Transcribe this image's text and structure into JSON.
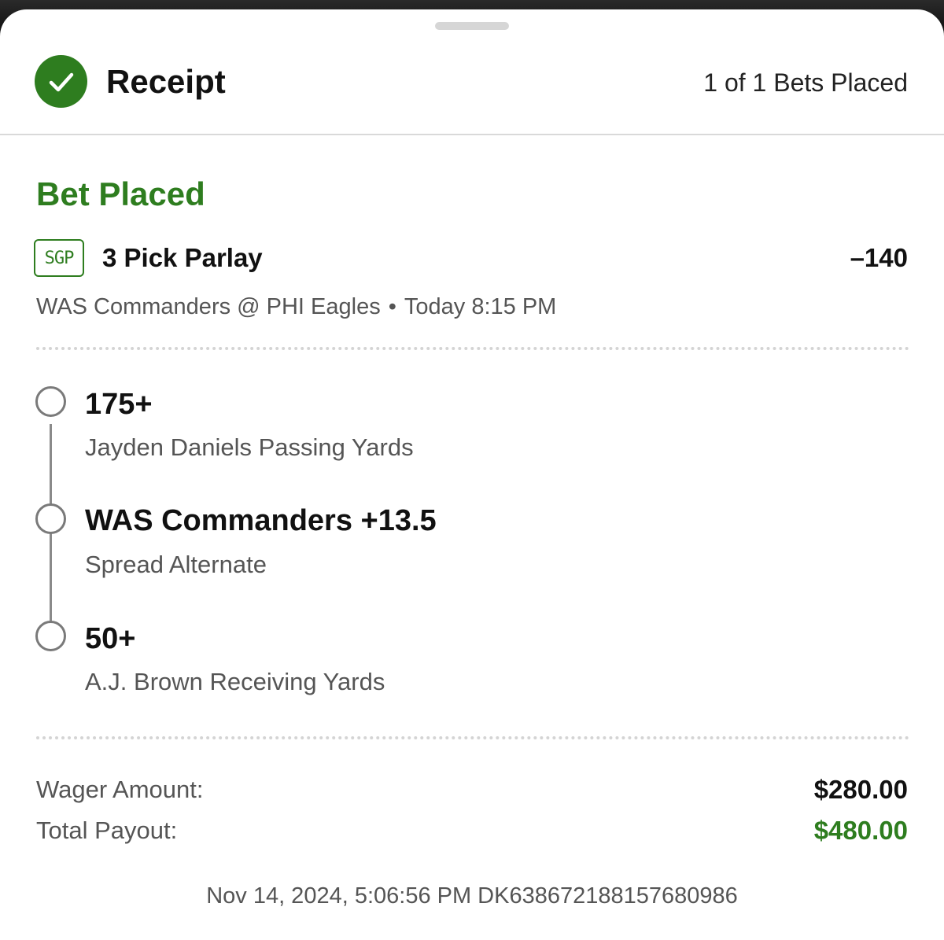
{
  "header": {
    "title": "Receipt",
    "bets_placed": "1 of 1 Bets Placed",
    "icon": "checkmark-circle-icon"
  },
  "bet": {
    "status": "Bet Placed",
    "badge": "SGP",
    "type": "3 Pick Parlay",
    "odds": "–140",
    "matchup": "WAS Commanders @ PHI Eagles",
    "separator": "•",
    "time": "Today 8:15 PM"
  },
  "legs": [
    {
      "pick": "175+",
      "market": "Jayden Daniels Passing Yards"
    },
    {
      "pick": "WAS Commanders +13.5",
      "market": "Spread Alternate"
    },
    {
      "pick": "50+",
      "market": "A.J. Brown Receiving Yards"
    }
  ],
  "summary": {
    "wager_label": "Wager Amount:",
    "wager_value": "$280.00",
    "payout_label": "Total Payout:",
    "payout_value": "$480.00"
  },
  "footer": {
    "text": "Nov 14, 2024, 5:06:56 PM DK638672188157680986"
  },
  "colors": {
    "accent_green": "#2e7d1f",
    "text_primary": "#111111",
    "text_secondary": "#555555"
  }
}
